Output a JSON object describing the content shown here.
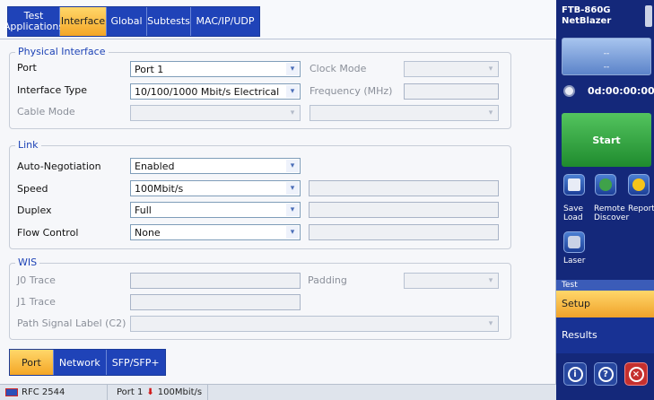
{
  "tabs": [
    {
      "label": "Test\nApplications",
      "active": false
    },
    {
      "label": "Interface",
      "active": true
    },
    {
      "label": "Global",
      "active": false
    },
    {
      "label": "Subtests",
      "active": false
    },
    {
      "label": "MAC/IP/UDP",
      "active": false
    }
  ],
  "physical": {
    "title": "Physical Interface",
    "port_label": "Port",
    "port_value": "Port 1",
    "clock_mode_label": "Clock Mode",
    "clock_mode_value": "--",
    "iface_type_label": "Interface Type",
    "iface_type_value": "10/100/1000 Mbit/s Electrical",
    "frequency_label": "Frequency (MHz)",
    "cable_mode_label": "Cable Mode"
  },
  "link": {
    "title": "Link",
    "autoneg_label": "Auto-Negotiation",
    "autoneg_value": "Enabled",
    "speed_label": "Speed",
    "speed_value": "100Mbit/s",
    "duplex_label": "Duplex",
    "duplex_value": "Full",
    "flow_label": "Flow Control",
    "flow_value": "None"
  },
  "wis": {
    "title": "WIS",
    "j0_label": "J0 Trace",
    "padding_label": "Padding",
    "j1_label": "J1 Trace",
    "psl_label": "Path Signal Label (C2)"
  },
  "bottom_tabs": [
    {
      "label": "Port",
      "active": true
    },
    {
      "label": "Network",
      "active": false
    },
    {
      "label": "SFP/SFP+",
      "active": false
    }
  ],
  "status": {
    "test": "RFC 2544",
    "port": "Port 1",
    "rate": "100Mbit/s"
  },
  "sidebar": {
    "device_line1": "FTB-860G",
    "device_line2": "NetBlazer",
    "meter_top": "--",
    "meter_bottom": "--",
    "timer": "0d:00:00:00",
    "start_label": "Start",
    "save_load_line1": "Save",
    "save_load_line2": "Load",
    "remote_line1": "Remote",
    "remote_line2": "Discover",
    "report_label": "Report",
    "laser_label": "Laser",
    "section_test": "Test",
    "section_setup": "Setup",
    "section_results": "Results",
    "about_icon": "i",
    "help_icon": "?",
    "close_icon": "×"
  },
  "icons": {
    "dropdown": "▾",
    "down_arrow": "⬇"
  },
  "colors": {
    "tab_blue": "#1f43b8",
    "active_orange": "#f4a626",
    "start_green": "#2ea53c",
    "sidebar_navy": "#14287a",
    "link_down_red": "#d01818"
  }
}
